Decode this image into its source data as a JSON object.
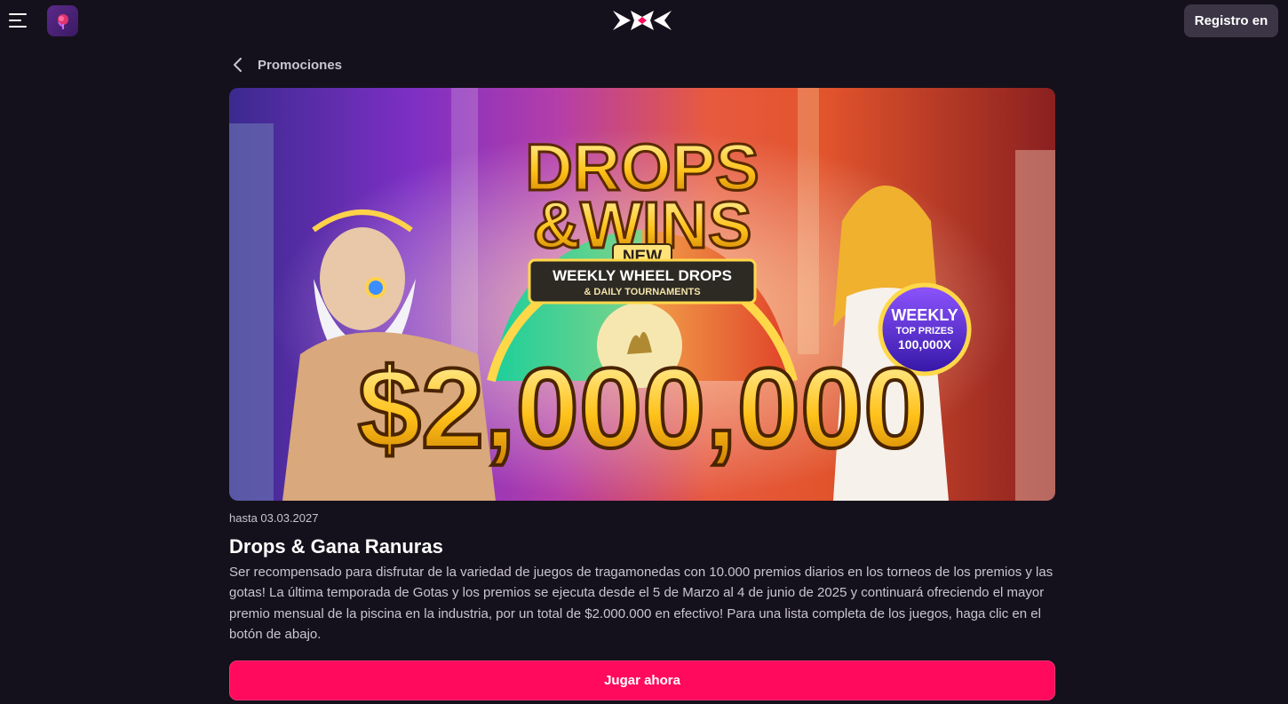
{
  "header": {
    "menu_icon": "hamburger-menu-icon",
    "app_icon": "app-icon",
    "logo_icon": "xx-logo-icon",
    "register_label": "Registro en"
  },
  "breadcrumb": {
    "back_icon": "chevron-left-icon",
    "label": "Promociones"
  },
  "banner": {
    "title_line1": "DROPS",
    "title_line2": "&WINS",
    "badge_new": "NEW",
    "badge_line1": "WEEKLY WHEEL DROPS",
    "badge_line2": "& DAILY TOURNAMENTS",
    "amount": "$2,000,000",
    "seal_line1": "WEEKLY",
    "seal_line2": "TOP PRIZES",
    "seal_line3": "100,000X"
  },
  "promo": {
    "date": "hasta 03.03.2027",
    "title": "Drops & Gana Ranuras",
    "description": "Ser recompensado para disfrutar de la variedad de juegos de tragamonedas con 10.000 premios diarios en los torneos de los premios y las gotas! La última temporada de Gotas y los premios se ejecuta desde el 5 de Marzo al 4 de junio de 2025 y continuará ofreciendo el mayor premio mensual de la piscina en la industria, por un total de $2.000.000 en efectivo! Para una lista completa de los juegos, haga clic en el botón de abajo.",
    "cta_label": "Jugar ahora"
  },
  "colors": {
    "background": "#15111c",
    "accent": "#ff0a5c",
    "register_bg": "#3b3545"
  }
}
